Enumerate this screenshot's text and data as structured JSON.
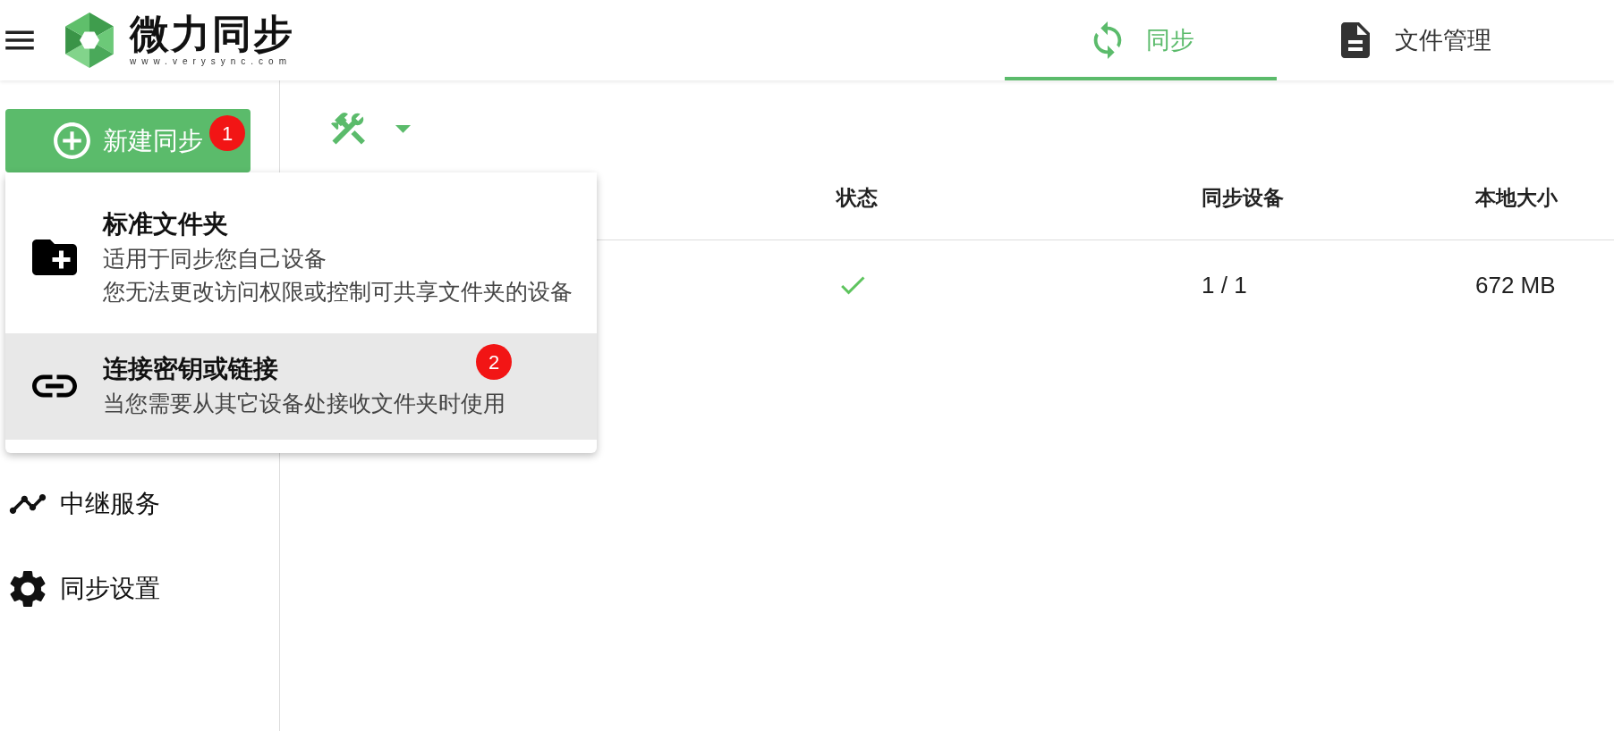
{
  "header": {
    "logo": {
      "name": "微力同步",
      "website": "www.verysync.com"
    },
    "tabs": [
      {
        "label": "同步",
        "kind": "sync",
        "selected": true
      },
      {
        "label": "文件管理",
        "kind": "files",
        "selected": false
      }
    ]
  },
  "sidebar": {
    "new_button": {
      "label": "新建同步",
      "badge": "1"
    },
    "items": [
      {
        "label": "中继服务",
        "kind": "relay"
      },
      {
        "label": "同步设置",
        "kind": "settings"
      }
    ]
  },
  "table": {
    "columns": [
      "状态",
      "同步设备",
      "本地大小"
    ],
    "rows": [
      {
        "synced": true,
        "devices": "1 / 1",
        "size": "672 MB"
      }
    ]
  },
  "dropdown_menu": {
    "items": [
      {
        "kind": "folder",
        "title": "标准文件夹",
        "description": [
          "适用于同步您自己设备",
          "您无法更改访问权限或控制可共享文件夹的设备"
        ],
        "selected": false
      },
      {
        "kind": "link",
        "title": "连接密钥或链接",
        "description": [
          "当您需要从其它设备处接收文件夹时使用"
        ],
        "selected": true,
        "badge": "2"
      }
    ]
  }
}
